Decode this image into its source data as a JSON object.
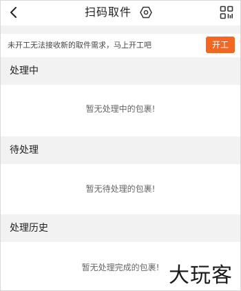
{
  "header": {
    "title": "扫码取件",
    "back_icon": "back-chevron-icon",
    "settings_icon": "hexagon-settings-icon",
    "scan_icon": "qr-scan-icon"
  },
  "notice": {
    "text": "未开工无法接收新的取件需求，马上开工吧",
    "button_label": "开工",
    "button_color": "#f26722"
  },
  "sections": [
    {
      "title": "处理中",
      "empty_text": "暂无处理中的包裹!"
    },
    {
      "title": "待处理",
      "empty_text": "暂无待处理的包裹!"
    },
    {
      "title": "处理历史",
      "empty_text": "暂无处理完成的包裹!"
    }
  ],
  "watermark": "大玩客",
  "colors": {
    "accent": "#f26722",
    "section_bg": "#f2f2f2",
    "empty_text": "#666666"
  }
}
